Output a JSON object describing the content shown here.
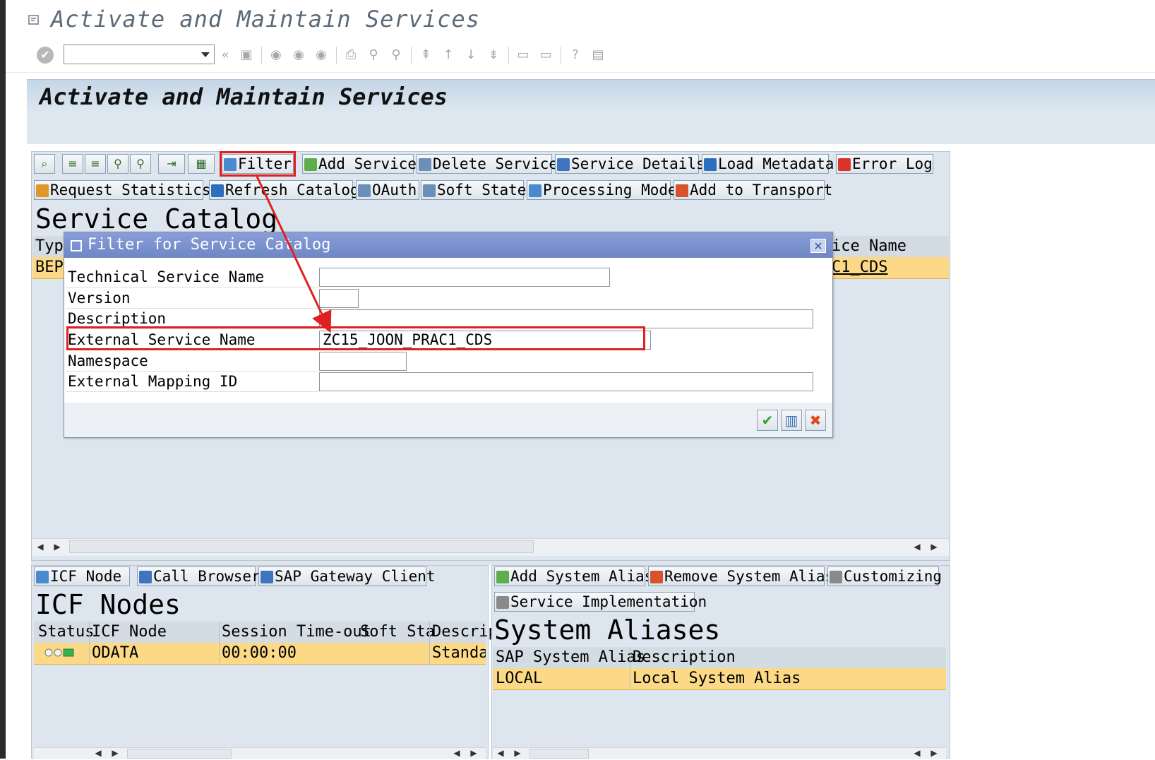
{
  "window": {
    "title": "Activate and Maintain Services"
  },
  "system_toolbar": {
    "command_field_value": ""
  },
  "screen": {
    "title": "Activate and Maintain Services"
  },
  "service_catalog": {
    "toolbar_row1": {
      "filter": "Filter",
      "add_service": "Add Service",
      "delete_service": "Delete Service",
      "service_details": "Service Details",
      "load_metadata": "Load Metadata",
      "error_log": "Error Log"
    },
    "toolbar_row2": {
      "request_statistics": "Request Statistics",
      "refresh_catalog": "Refresh Catalog",
      "oauth": "OAuth",
      "soft_state": "Soft State",
      "processing_mode": "Processing Mode",
      "add_to_transport": "Add to Transport"
    },
    "title": "Service Catalog",
    "columns": {
      "type": "Type",
      "service_name_partial": "ice Name"
    },
    "rows": [
      {
        "type": "BEP",
        "service_name_partial": "C1_CDS"
      }
    ]
  },
  "filter_dialog": {
    "title": "Filter for Service Catalog",
    "fields": {
      "technical_service_name": {
        "label": "Technical Service Name",
        "value": ""
      },
      "version": {
        "label": "Version",
        "value": ""
      },
      "description": {
        "label": "Description",
        "value": ""
      },
      "external_service_name": {
        "label": "External Service Name",
        "value": "ZC15_JOON_PRAC1_CDS"
      },
      "namespace": {
        "label": "Namespace",
        "value": ""
      },
      "external_mapping_id": {
        "label": "External Mapping ID",
        "value": ""
      }
    }
  },
  "icf_nodes": {
    "toolbar": {
      "icf_node": "ICF Node",
      "call_browser": "Call Browser",
      "sap_gateway_client": "SAP Gateway Client"
    },
    "title": "ICF Nodes",
    "columns": {
      "status": "Status",
      "icf_node": "ICF Node",
      "session_timeout": "Session Time-out",
      "soft_state": "Soft Sta",
      "description": "Descrip"
    },
    "rows": [
      {
        "icf_node": "ODATA",
        "session_timeout": "00:00:00",
        "description": "Standar"
      }
    ]
  },
  "system_aliases": {
    "toolbar": {
      "add_system_alias": "Add System Alias",
      "remove_system_alias": "Remove System Alias",
      "customizing": "Customizing",
      "service_implementation": "Service Implementation"
    },
    "title": "System Aliases",
    "columns": {
      "sap_system_alias": "SAP System Alias",
      "description": "Description"
    },
    "rows": [
      {
        "sap_system_alias": "LOCAL",
        "description": "Local System Alias"
      }
    ]
  },
  "colors": {
    "selected_row": "#fbd986",
    "annotation_red": "#e02020",
    "dialog_title_bar": "#7b90cf"
  }
}
